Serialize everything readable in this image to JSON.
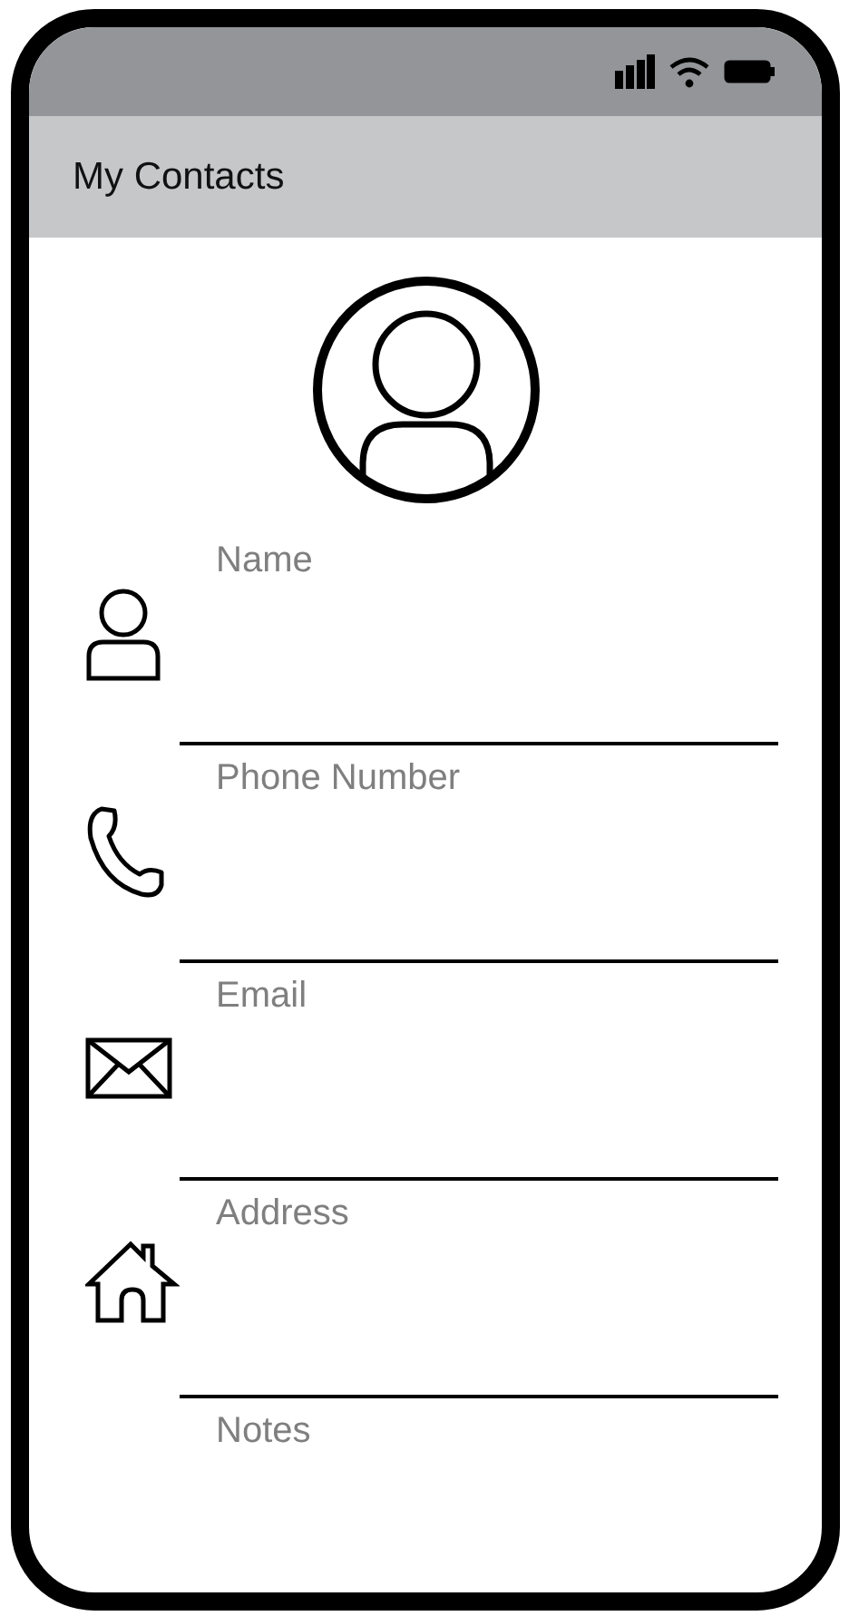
{
  "header": {
    "title": "My Contacts"
  },
  "fields": [
    {
      "kind": "person",
      "placeholder": "Name"
    },
    {
      "kind": "phone",
      "placeholder": "Phone Number"
    },
    {
      "kind": "mail",
      "placeholder": "Email"
    },
    {
      "kind": "home",
      "placeholder": "Address"
    },
    {
      "kind": "text",
      "placeholder": "Notes"
    }
  ]
}
